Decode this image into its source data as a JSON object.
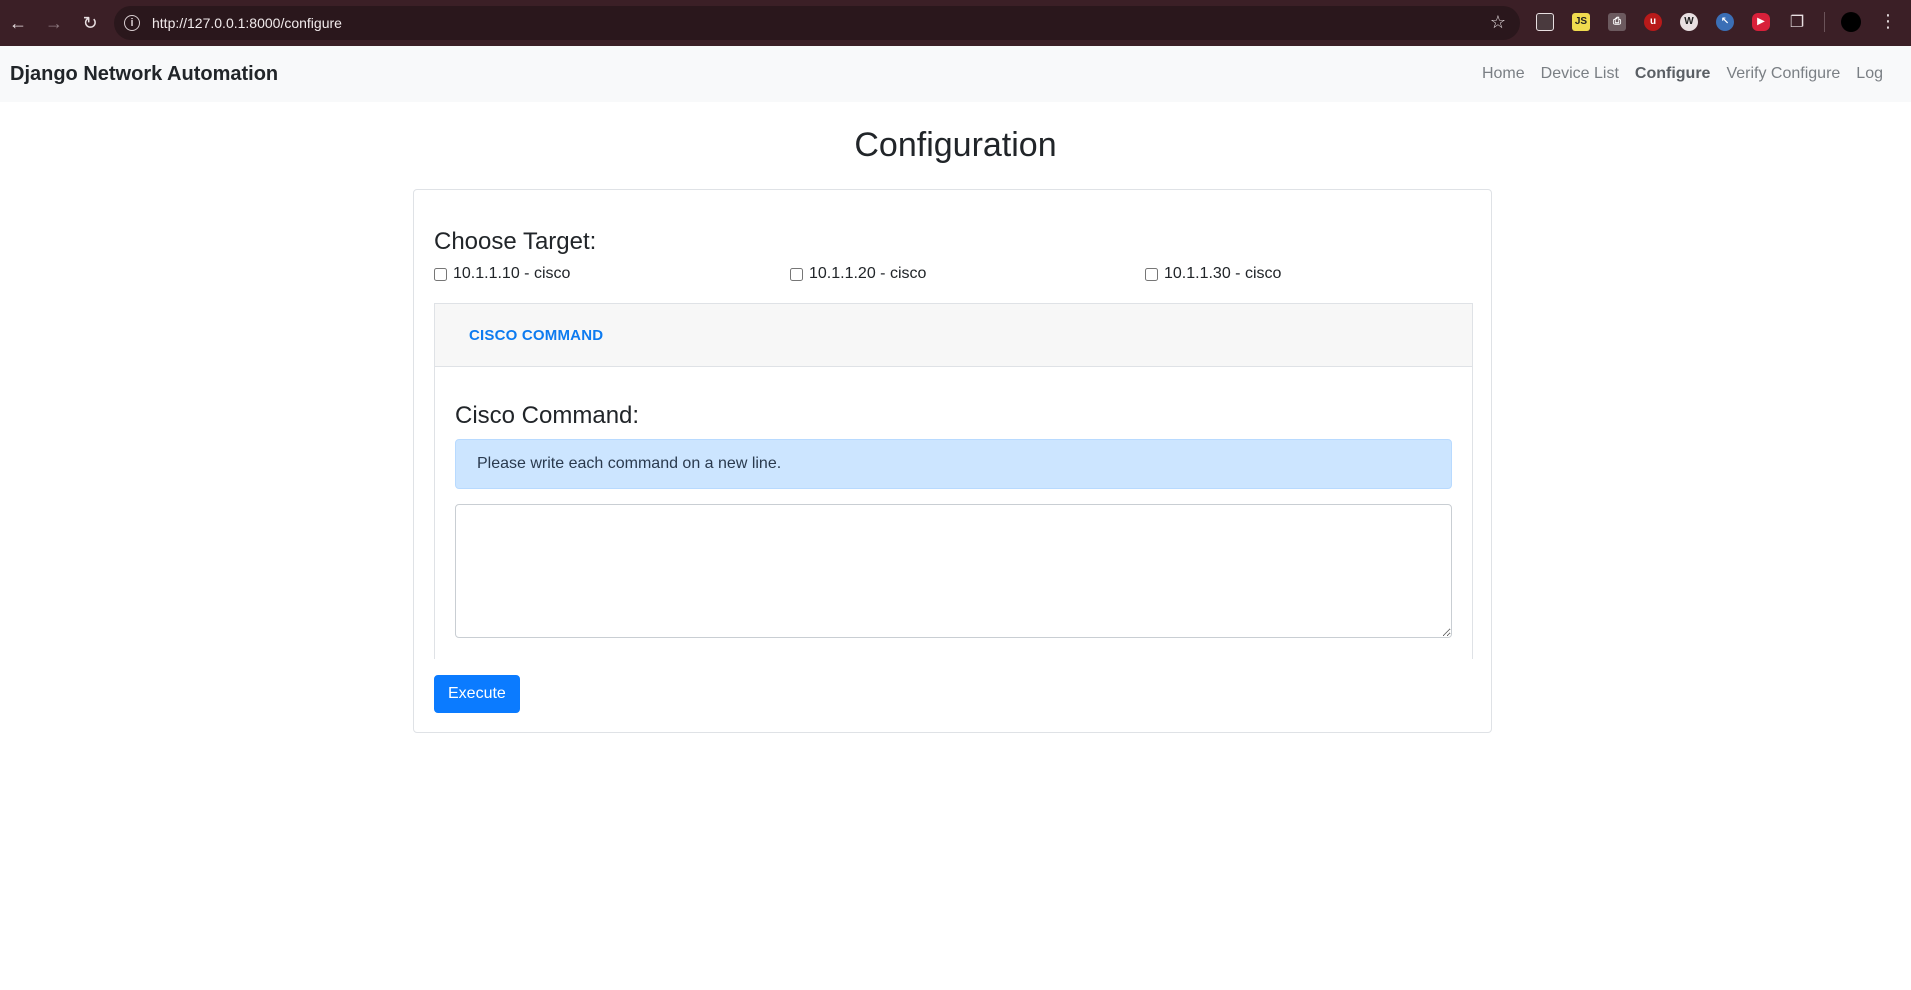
{
  "browser": {
    "url": "http://127.0.0.1:8000/configure",
    "info_icon": "info-icon",
    "extensions": [
      {
        "name": "tab-icon",
        "color": "#4a3a3e"
      },
      {
        "name": "js-extension-icon",
        "color": "#f0db4f"
      },
      {
        "name": "printer-icon",
        "color": "#4a3a3e"
      },
      {
        "name": "ublock-icon",
        "color": "#b81a1a"
      },
      {
        "name": "wappalyzer-icon",
        "color": "#4a3a3e"
      },
      {
        "name": "cursor-extension-icon",
        "color": "#3b6fb6"
      },
      {
        "name": "video-speed-icon",
        "color": "#d8203a"
      },
      {
        "name": "extensions-puzzle-icon",
        "color": "#4a3a3e"
      }
    ]
  },
  "navbar": {
    "brand": "Django Network Automation",
    "links": [
      {
        "label": "Home",
        "active": false
      },
      {
        "label": "Device List",
        "active": false
      },
      {
        "label": "Configure",
        "active": true
      },
      {
        "label": "Verify Configure",
        "active": false
      },
      {
        "label": "Log",
        "active": false
      }
    ]
  },
  "page": {
    "title": "Configuration",
    "choose_target_label": "Choose Target:",
    "targets": [
      {
        "label": "10.1.1.10 - cisco",
        "checked": false
      },
      {
        "label": "10.1.1.20 - cisco",
        "checked": false
      },
      {
        "label": "10.1.1.30 - cisco",
        "checked": false
      }
    ],
    "tab_label": "CISCO COMMAND",
    "command_title": "Cisco Command:",
    "alert_text": "Please write each command on a new line.",
    "command_value": "",
    "execute_label": "Execute"
  },
  "colors": {
    "accent": "#0b7bff",
    "alert_bg": "#cce5ff",
    "navbar_bg": "#f8f9fa",
    "chrome_bg": "#3b1f26"
  }
}
